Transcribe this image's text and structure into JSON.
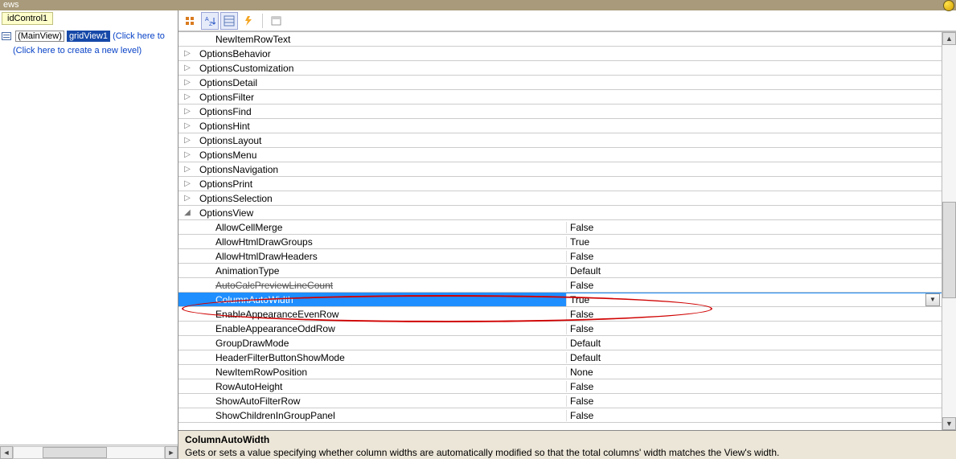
{
  "titlebar": {
    "text": "ews"
  },
  "left": {
    "control": "idControl1",
    "mainview": "(MainView)",
    "gridview": "gridView1",
    "click_to": "(Click here to",
    "create_level": "(Click here to create a new level)"
  },
  "toolbar_icons": [
    "categorized",
    "alphabetical",
    "properties",
    "events",
    "",
    "filter"
  ],
  "rows": [
    {
      "exp": "",
      "name": "NewItemRowText",
      "val": "",
      "indent": 1
    },
    {
      "exp": "▷",
      "name": "OptionsBehavior",
      "val": ""
    },
    {
      "exp": "▷",
      "name": "OptionsCustomization",
      "val": ""
    },
    {
      "exp": "▷",
      "name": "OptionsDetail",
      "val": ""
    },
    {
      "exp": "▷",
      "name": "OptionsFilter",
      "val": ""
    },
    {
      "exp": "▷",
      "name": "OptionsFind",
      "val": ""
    },
    {
      "exp": "▷",
      "name": "OptionsHint",
      "val": ""
    },
    {
      "exp": "▷",
      "name": "OptionsLayout",
      "val": ""
    },
    {
      "exp": "▷",
      "name": "OptionsMenu",
      "val": ""
    },
    {
      "exp": "▷",
      "name": "OptionsNavigation",
      "val": ""
    },
    {
      "exp": "▷",
      "name": "OptionsPrint",
      "val": ""
    },
    {
      "exp": "▷",
      "name": "OptionsSelection",
      "val": ""
    },
    {
      "exp": "◢",
      "name": "OptionsView",
      "val": ""
    },
    {
      "exp": "",
      "name": "AllowCellMerge",
      "val": "False",
      "indent": 1
    },
    {
      "exp": "",
      "name": "AllowHtmlDrawGroups",
      "val": "True",
      "indent": 1
    },
    {
      "exp": "",
      "name": "AllowHtmlDrawHeaders",
      "val": "False",
      "indent": 1
    },
    {
      "exp": "",
      "name": "AnimationType",
      "val": "Default",
      "indent": 1
    },
    {
      "exp": "",
      "name": "AutoCalcPreviewLineCount",
      "val": "False",
      "indent": 1,
      "strike": true
    },
    {
      "exp": "",
      "name": "ColumnAutoWidth",
      "val": "True",
      "indent": 1,
      "selected": true,
      "dd": true
    },
    {
      "exp": "",
      "name": "EnableAppearanceEvenRow",
      "val": "False",
      "indent": 1
    },
    {
      "exp": "",
      "name": "EnableAppearanceOddRow",
      "val": "False",
      "indent": 1
    },
    {
      "exp": "",
      "name": "GroupDrawMode",
      "val": "Default",
      "indent": 1
    },
    {
      "exp": "",
      "name": "HeaderFilterButtonShowMode",
      "val": "Default",
      "indent": 1
    },
    {
      "exp": "",
      "name": "NewItemRowPosition",
      "val": "None",
      "indent": 1
    },
    {
      "exp": "",
      "name": "RowAutoHeight",
      "val": "False",
      "indent": 1
    },
    {
      "exp": "",
      "name": "ShowAutoFilterRow",
      "val": "False",
      "indent": 1
    },
    {
      "exp": "",
      "name": "ShowChildrenInGroupPanel",
      "val": "False",
      "indent": 1
    }
  ],
  "desc": {
    "title": "ColumnAutoWidth",
    "text": "Gets or sets a value specifying whether column widths are automatically modified so that the total columns' width matches the View's width."
  }
}
